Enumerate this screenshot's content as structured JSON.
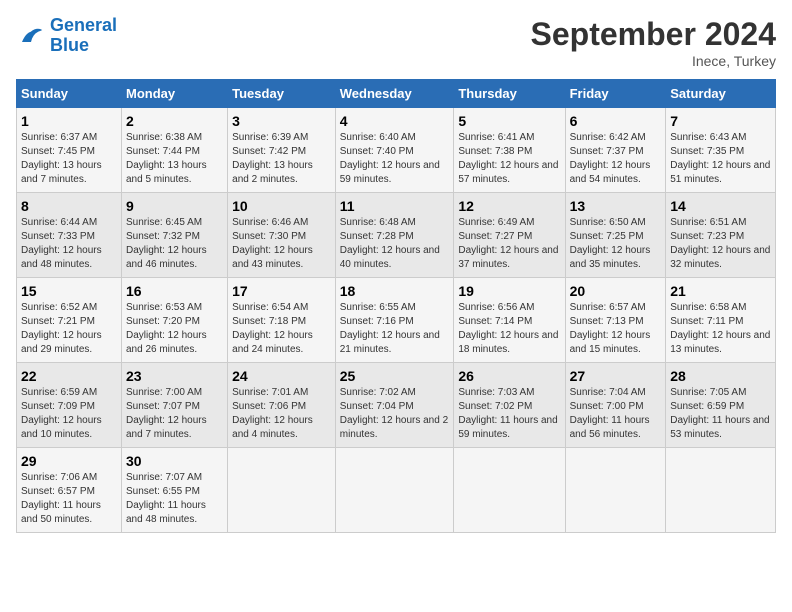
{
  "logo": {
    "line1": "General",
    "line2": "Blue"
  },
  "title": "September 2024",
  "location": "Inece, Turkey",
  "days_header": [
    "Sunday",
    "Monday",
    "Tuesday",
    "Wednesday",
    "Thursday",
    "Friday",
    "Saturday"
  ],
  "weeks": [
    [
      {
        "day": "1",
        "sunrise": "6:37 AM",
        "sunset": "7:45 PM",
        "daylight": "13 hours and 7 minutes."
      },
      {
        "day": "2",
        "sunrise": "6:38 AM",
        "sunset": "7:44 PM",
        "daylight": "13 hours and 5 minutes."
      },
      {
        "day": "3",
        "sunrise": "6:39 AM",
        "sunset": "7:42 PM",
        "daylight": "13 hours and 2 minutes."
      },
      {
        "day": "4",
        "sunrise": "6:40 AM",
        "sunset": "7:40 PM",
        "daylight": "12 hours and 59 minutes."
      },
      {
        "day": "5",
        "sunrise": "6:41 AM",
        "sunset": "7:38 PM",
        "daylight": "12 hours and 57 minutes."
      },
      {
        "day": "6",
        "sunrise": "6:42 AM",
        "sunset": "7:37 PM",
        "daylight": "12 hours and 54 minutes."
      },
      {
        "day": "7",
        "sunrise": "6:43 AM",
        "sunset": "7:35 PM",
        "daylight": "12 hours and 51 minutes."
      }
    ],
    [
      {
        "day": "8",
        "sunrise": "6:44 AM",
        "sunset": "7:33 PM",
        "daylight": "12 hours and 48 minutes."
      },
      {
        "day": "9",
        "sunrise": "6:45 AM",
        "sunset": "7:32 PM",
        "daylight": "12 hours and 46 minutes."
      },
      {
        "day": "10",
        "sunrise": "6:46 AM",
        "sunset": "7:30 PM",
        "daylight": "12 hours and 43 minutes."
      },
      {
        "day": "11",
        "sunrise": "6:48 AM",
        "sunset": "7:28 PM",
        "daylight": "12 hours and 40 minutes."
      },
      {
        "day": "12",
        "sunrise": "6:49 AM",
        "sunset": "7:27 PM",
        "daylight": "12 hours and 37 minutes."
      },
      {
        "day": "13",
        "sunrise": "6:50 AM",
        "sunset": "7:25 PM",
        "daylight": "12 hours and 35 minutes."
      },
      {
        "day": "14",
        "sunrise": "6:51 AM",
        "sunset": "7:23 PM",
        "daylight": "12 hours and 32 minutes."
      }
    ],
    [
      {
        "day": "15",
        "sunrise": "6:52 AM",
        "sunset": "7:21 PM",
        "daylight": "12 hours and 29 minutes."
      },
      {
        "day": "16",
        "sunrise": "6:53 AM",
        "sunset": "7:20 PM",
        "daylight": "12 hours and 26 minutes."
      },
      {
        "day": "17",
        "sunrise": "6:54 AM",
        "sunset": "7:18 PM",
        "daylight": "12 hours and 24 minutes."
      },
      {
        "day": "18",
        "sunrise": "6:55 AM",
        "sunset": "7:16 PM",
        "daylight": "12 hours and 21 minutes."
      },
      {
        "day": "19",
        "sunrise": "6:56 AM",
        "sunset": "7:14 PM",
        "daylight": "12 hours and 18 minutes."
      },
      {
        "day": "20",
        "sunrise": "6:57 AM",
        "sunset": "7:13 PM",
        "daylight": "12 hours and 15 minutes."
      },
      {
        "day": "21",
        "sunrise": "6:58 AM",
        "sunset": "7:11 PM",
        "daylight": "12 hours and 13 minutes."
      }
    ],
    [
      {
        "day": "22",
        "sunrise": "6:59 AM",
        "sunset": "7:09 PM",
        "daylight": "12 hours and 10 minutes."
      },
      {
        "day": "23",
        "sunrise": "7:00 AM",
        "sunset": "7:07 PM",
        "daylight": "12 hours and 7 minutes."
      },
      {
        "day": "24",
        "sunrise": "7:01 AM",
        "sunset": "7:06 PM",
        "daylight": "12 hours and 4 minutes."
      },
      {
        "day": "25",
        "sunrise": "7:02 AM",
        "sunset": "7:04 PM",
        "daylight": "12 hours and 2 minutes."
      },
      {
        "day": "26",
        "sunrise": "7:03 AM",
        "sunset": "7:02 PM",
        "daylight": "11 hours and 59 minutes."
      },
      {
        "day": "27",
        "sunrise": "7:04 AM",
        "sunset": "7:00 PM",
        "daylight": "11 hours and 56 minutes."
      },
      {
        "day": "28",
        "sunrise": "7:05 AM",
        "sunset": "6:59 PM",
        "daylight": "11 hours and 53 minutes."
      }
    ],
    [
      {
        "day": "29",
        "sunrise": "7:06 AM",
        "sunset": "6:57 PM",
        "daylight": "11 hours and 50 minutes."
      },
      {
        "day": "30",
        "sunrise": "7:07 AM",
        "sunset": "6:55 PM",
        "daylight": "11 hours and 48 minutes."
      },
      null,
      null,
      null,
      null,
      null
    ]
  ],
  "labels": {
    "sunrise": "Sunrise:",
    "sunset": "Sunset:",
    "daylight": "Daylight:"
  }
}
